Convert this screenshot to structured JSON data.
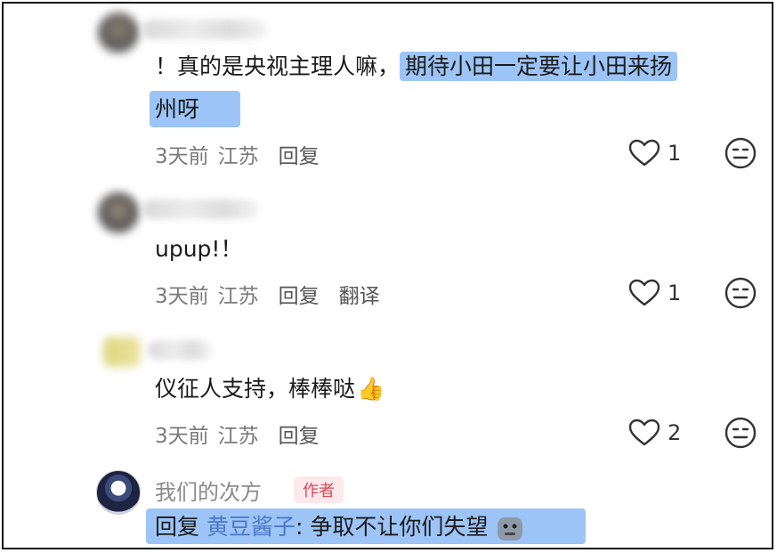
{
  "comments": [
    {
      "text_plain": "！真的是央视主理人嘛，",
      "text_highlight": "期待小田一定要让小田来扬",
      "text_line2": "州呀",
      "time": "3天前",
      "location": "江苏",
      "reply_label": "回复",
      "likes": "1"
    },
    {
      "text": "upup!！",
      "time": "3天前",
      "location": "江苏",
      "reply_label": "回复",
      "translate_label": "翻译",
      "likes": "1"
    },
    {
      "text": "仪征人支持，棒棒哒",
      "emoji": "👍",
      "time": "3天前",
      "location": "江苏",
      "reply_label": "回复",
      "likes": "2"
    }
  ],
  "author_reply": {
    "name": "我们的次方",
    "badge": "作者",
    "reply_prefix": "回复",
    "mention": "黄豆酱子",
    "text": ": 争取不让你们失望"
  },
  "icons": {
    "like": "heart-outline-icon",
    "react": "neutral-face-icon"
  },
  "colors": {
    "highlight": "#9cc4f7",
    "meta_text": "#7a7a7a",
    "badge_text": "#d9475a",
    "mention": "#4a78c8"
  }
}
